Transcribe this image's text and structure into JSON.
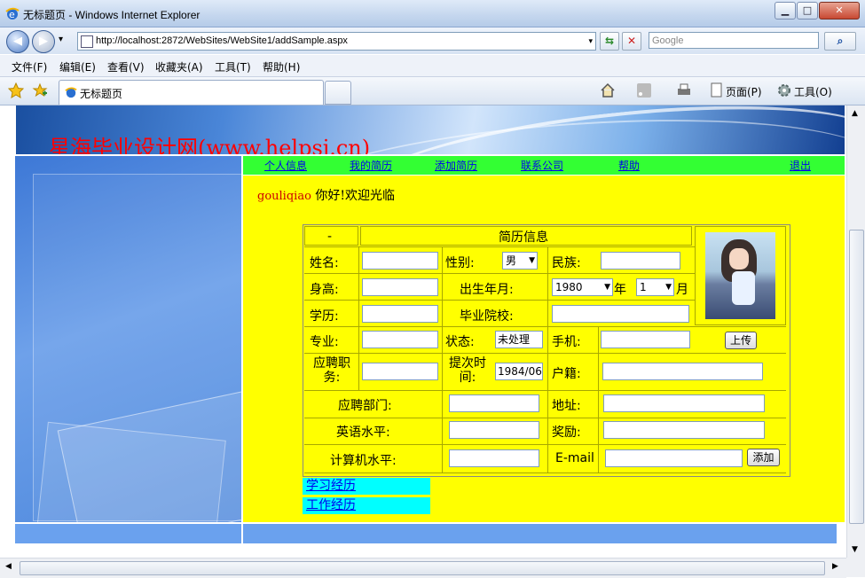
{
  "window": {
    "title": "无标题页 - Windows Internet Explorer",
    "min": "▁",
    "max": "□",
    "close": "✕"
  },
  "addressbar": {
    "back": "◀",
    "forward": "▶",
    "history": "▾",
    "url": "http://localhost:2872/WebSites/WebSite1/addSample.aspx",
    "dropdown": "▾",
    "refresh": "⇆",
    "stop": "✕",
    "search_placeholder": "Google",
    "search_btn": "⌕"
  },
  "menu": [
    "文件(F)",
    "编辑(E)",
    "查看(V)",
    "收藏夹(A)",
    "工具(T)",
    "帮助(H)"
  ],
  "favbar": {
    "tab_title": "无标题页",
    "page_label": "页面(P)",
    "tools_label": "工具(O)"
  },
  "site": {
    "title": "星海毕业设计网(www.helpsj.cn)",
    "nav": [
      "个人信息",
      "我的简历",
      "添加简历",
      "联系公司",
      "帮助",
      "退出"
    ],
    "username": "gouliqiao",
    "greeting": "你好!欢迎光临"
  },
  "form": {
    "dash": "-",
    "header": "简历信息",
    "name_label": "姓名:",
    "gender_label": "性别:",
    "gender_value": "男",
    "ethnic_label": "民族:",
    "height_label": "身高:",
    "birth_label": "出生年月:",
    "birth_year": "1980",
    "year_unit": "年",
    "birth_month": "1",
    "month_unit": "月",
    "edu_label": "学历:",
    "school_label": "毕业院校:",
    "major_label": "专业:",
    "status_label": "状态:",
    "status_value": "未处理",
    "mobile_label": "手机:",
    "upload_btn": "上传",
    "position_label": "应聘职务:",
    "submit_time_label": "提次时间:",
    "submit_time_value": "1984/06/",
    "hukou_label": "户籍:",
    "dept_label": "应聘部门:",
    "address_label": "地址:",
    "english_label": "英语水平:",
    "award_label": "奖励:",
    "computer_label": "计算机水平:",
    "email_label": "E-mail",
    "add_btn": "添加"
  },
  "links": [
    "学习经历",
    "工作经历"
  ],
  "colors": {
    "nav_bg": "#33ff33",
    "content_bg": "#ffff00",
    "link_bg": "#00ffff",
    "title": "#ff0000"
  }
}
